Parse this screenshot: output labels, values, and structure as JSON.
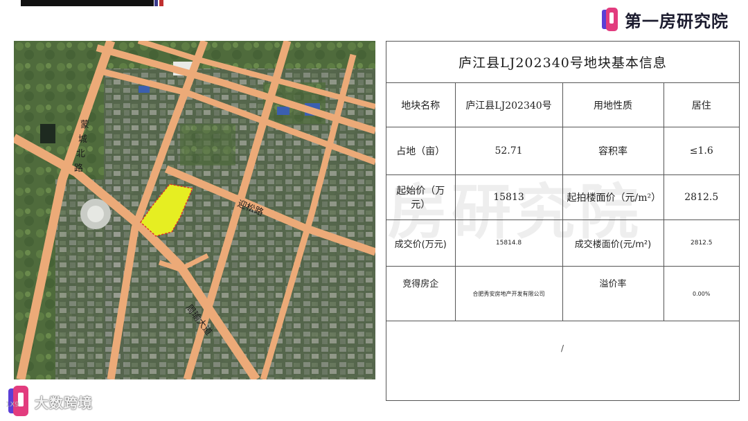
{
  "brand": {
    "name": "第一房研究院",
    "colors": {
      "mark_pink": "#e23c7e",
      "mark_purple": "#5b3fd6"
    }
  },
  "map": {
    "roads": [
      {
        "label": "蒙城北路"
      },
      {
        "label": "迎松路"
      },
      {
        "label": "周瑜大道"
      }
    ],
    "parcel_color": "#e6ee22"
  },
  "info": {
    "title": "庐江县LJ202340号地块基本信息",
    "rows": {
      "r1": {
        "k1": "地块名称",
        "v1": "庐江县LJ202340号",
        "k2": "用地性质",
        "v2": "居住"
      },
      "r2": {
        "k1": "占地（亩）",
        "v1": "52.71",
        "k2": "容积率",
        "v2": "≤1.6"
      },
      "r3": {
        "k1": "起始价（万元）",
        "v1": "15813",
        "k2": "起拍楼面价（元/m²）",
        "v2": "2812.5"
      },
      "r4": {
        "k1": "成交价(万元)",
        "v1": "15814.8",
        "k2": "成交楼面价(元/m²)",
        "v2": "2812.5"
      },
      "r5": {
        "k1": "竞得房企",
        "v1": "合肥秀安房地产开发有限公司",
        "k2": "溢价率",
        "v2": "0.00%"
      }
    },
    "note": "/"
  },
  "watermark": "房研究院",
  "bottom_logo": {
    "text": "大数跨境",
    "sup": "1X9"
  }
}
